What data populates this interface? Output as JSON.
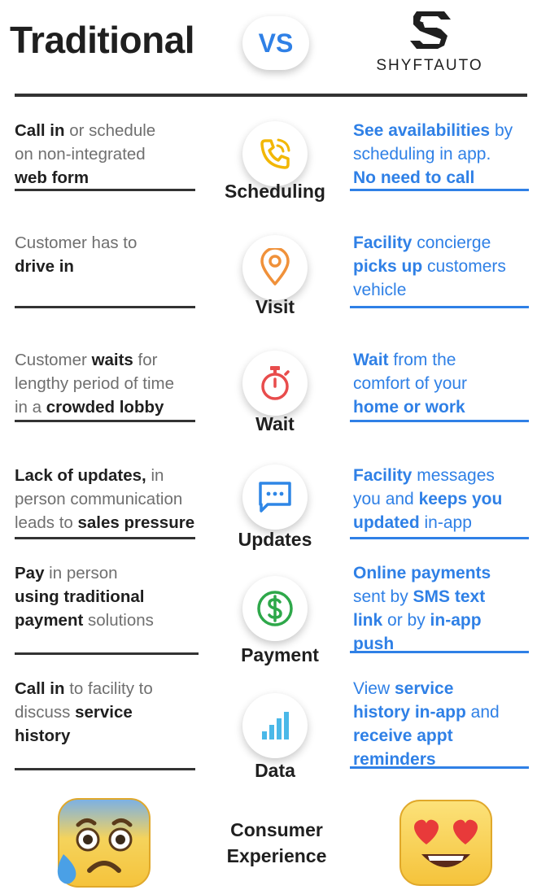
{
  "header": {
    "left_title": "Traditional",
    "vs": "VS",
    "brand": "SHYFTAUTO"
  },
  "rows": [
    {
      "stage": "Scheduling",
      "icon": "phone-icon",
      "icon_color": "#f2b705",
      "left": [
        [
          {
            "t": "Call in",
            "b": true
          },
          {
            "t": " or schedule",
            "b": false
          }
        ],
        [
          {
            "t": "on non-integrated",
            "b": false
          }
        ],
        [
          {
            "t": "web form",
            "b": true
          }
        ]
      ],
      "right": [
        [
          {
            "t": "See availabilities",
            "b": true
          },
          {
            "t": " by",
            "b": false
          }
        ],
        [
          {
            "t": "scheduling in app.",
            "b": false
          }
        ],
        [
          {
            "t": "No need to call",
            "b": true
          }
        ]
      ]
    },
    {
      "stage": "Visit",
      "icon": "map-pin-icon",
      "icon_color": "#f0913a",
      "left": [
        [
          {
            "t": "Customer has to",
            "b": false
          }
        ],
        [
          {
            "t": "drive in",
            "b": true
          }
        ]
      ],
      "right": [
        [
          {
            "t": "Facility",
            "b": true
          },
          {
            "t": " concierge",
            "b": false
          }
        ],
        [
          {
            "t": "picks up",
            "b": true
          },
          {
            "t": " customers",
            "b": false
          }
        ],
        [
          {
            "t": "vehicle",
            "b": false
          }
        ]
      ]
    },
    {
      "stage": "Wait",
      "icon": "stopwatch-icon",
      "icon_color": "#e84c4c",
      "left": [
        [
          {
            "t": "Customer ",
            "b": false
          },
          {
            "t": "waits",
            "b": true
          },
          {
            "t": " for",
            "b": false
          }
        ],
        [
          {
            "t": "lengthy period of time",
            "b": false
          }
        ],
        [
          {
            "t": "in a ",
            "b": false
          },
          {
            "t": "crowded lobby",
            "b": true
          }
        ]
      ],
      "right": [
        [
          {
            "t": "Wait",
            "b": true
          },
          {
            "t": " from the",
            "b": false
          }
        ],
        [
          {
            "t": "comfort of your",
            "b": false
          }
        ],
        [
          {
            "t": "home or work",
            "b": true
          }
        ]
      ]
    },
    {
      "stage": "Updates",
      "icon": "message-icon",
      "icon_color": "#2e86e6",
      "left": [
        [
          {
            "t": "Lack of updates,",
            "b": true
          },
          {
            "t": " in",
            "b": false
          }
        ],
        [
          {
            "t": "person communication",
            "b": false
          }
        ],
        [
          {
            "t": "leads to ",
            "b": false
          },
          {
            "t": "sales pressure",
            "b": true
          }
        ]
      ],
      "right": [
        [
          {
            "t": "Facility",
            "b": true
          },
          {
            "t": " messages",
            "b": false
          }
        ],
        [
          {
            "t": "you and ",
            "b": false
          },
          {
            "t": "keeps you",
            "b": true
          }
        ],
        [
          {
            "t": "updated",
            "b": true
          },
          {
            "t": " in-app",
            "b": false
          }
        ]
      ]
    },
    {
      "stage": "Payment",
      "icon": "dollar-icon",
      "icon_color": "#2ea84a",
      "left": [
        [
          {
            "t": "Pay",
            "b": true
          },
          {
            "t": " in person",
            "b": false
          }
        ],
        [
          {
            "t": "using traditional",
            "b": true
          }
        ],
        [
          {
            "t": "payment",
            "b": true
          },
          {
            "t": " solutions",
            "b": false
          }
        ]
      ],
      "right": [
        [
          {
            "t": "Online payments",
            "b": true
          }
        ],
        [
          {
            "t": "sent by ",
            "b": false
          },
          {
            "t": "SMS text",
            "b": true
          }
        ],
        [
          {
            "t": "link",
            "b": true
          },
          {
            "t": " or by ",
            "b": false
          },
          {
            "t": "in-app",
            "b": true
          }
        ],
        [
          {
            "t": "push",
            "b": true
          }
        ]
      ]
    },
    {
      "stage": "Data",
      "icon": "bar-chart-icon",
      "icon_color": "#4ab8e8",
      "left": [
        [
          {
            "t": "Call in",
            "b": true
          },
          {
            "t": " to facility to",
            "b": false
          }
        ],
        [
          {
            "t": "discuss ",
            "b": false
          },
          {
            "t": "service",
            "b": true
          }
        ],
        [
          {
            "t": "history",
            "b": true
          }
        ]
      ],
      "right": [
        [
          {
            "t": "View ",
            "b": false
          },
          {
            "t": "service",
            "b": true
          }
        ],
        [
          {
            "t": "history in-app",
            "b": true
          },
          {
            "t": " and",
            "b": false
          }
        ],
        [
          {
            "t": "receive appt",
            "b": true
          }
        ],
        [
          {
            "t": "reminders",
            "b": true
          }
        ]
      ]
    }
  ],
  "footer": {
    "line1": "Consumer",
    "line2": "Experience",
    "left_emoji": "anxious-sweat-emoji",
    "right_emoji": "heart-eyes-emoji"
  },
  "colors": {
    "accent_blue": "#2f80e6",
    "dark": "#1f1f1f",
    "gray_text": "#6f6f6f"
  }
}
